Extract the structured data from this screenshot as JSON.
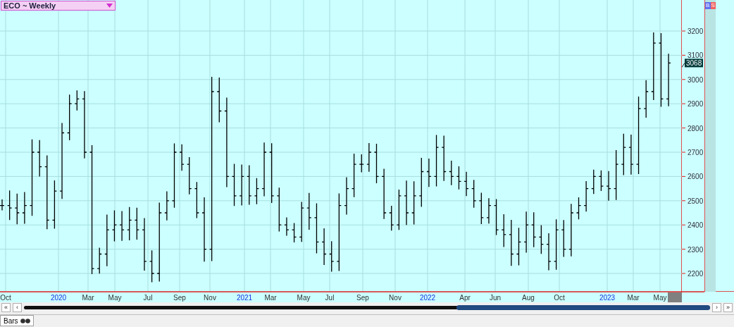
{
  "symbol_selector": {
    "label": "ECO ~ Weekly"
  },
  "side_buttons": [
    "B",
    "S"
  ],
  "chart": {
    "last_price": "3068",
    "y_axis_labels": [
      "3200",
      "3100",
      "3000",
      "2900",
      "2800",
      "2700",
      "2600",
      "2500",
      "2400",
      "2300",
      "2200"
    ],
    "x_axis_labels": [
      {
        "label": "Oct",
        "kind": "month"
      },
      {
        "label": "2020",
        "kind": "year"
      },
      {
        "label": "Mar",
        "kind": "month"
      },
      {
        "label": "May",
        "kind": "month"
      },
      {
        "label": "Jul",
        "kind": "month"
      },
      {
        "label": "Sep",
        "kind": "month"
      },
      {
        "label": "Nov",
        "kind": "month"
      },
      {
        "label": "2021",
        "kind": "year"
      },
      {
        "label": "Mar",
        "kind": "month"
      },
      {
        "label": "May",
        "kind": "month"
      },
      {
        "label": "Jul",
        "kind": "month"
      },
      {
        "label": "Sep",
        "kind": "month"
      },
      {
        "label": "Nov",
        "kind": "month"
      },
      {
        "label": "2022",
        "kind": "year"
      },
      {
        "label": "Apr",
        "kind": "month"
      },
      {
        "label": "Jun",
        "kind": "month"
      },
      {
        "label": "Aug",
        "kind": "month"
      },
      {
        "label": "Oct",
        "kind": "month"
      },
      {
        "label": "2023",
        "kind": "year"
      },
      {
        "label": "Mar",
        "kind": "month"
      },
      {
        "label": "May",
        "kind": "month"
      }
    ]
  },
  "scrollbar": {
    "buttons": [
      "«",
      "‹",
      "›",
      "»"
    ]
  },
  "status_bar": {
    "tab": "Bars"
  }
}
